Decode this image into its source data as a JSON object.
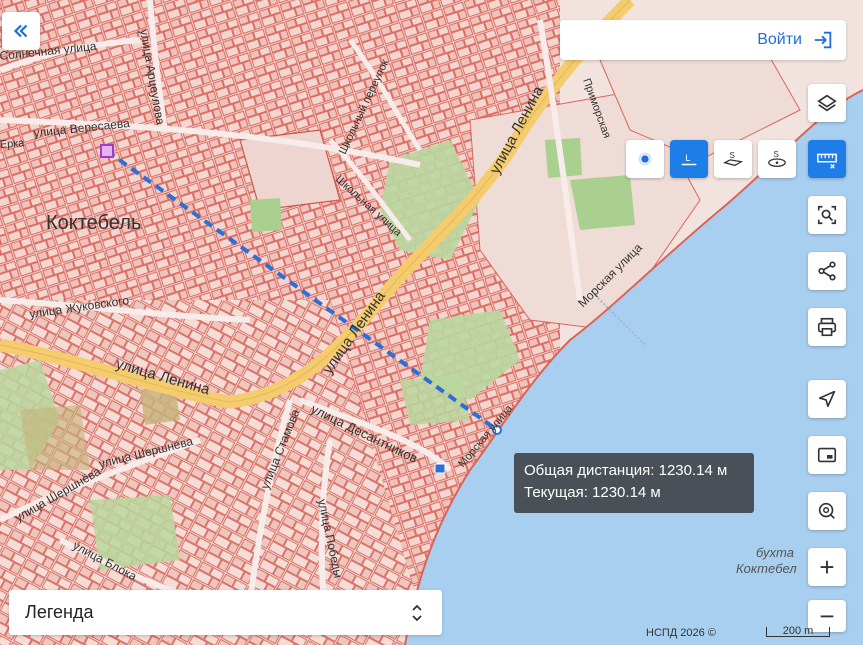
{
  "header": {
    "collapse_icon": "double-chevron-left-icon",
    "login_label": "Войти",
    "login_icon": "sign-in-icon"
  },
  "map": {
    "town_label": "Коктебель",
    "bay_label_1": "бухта",
    "bay_label_2": "Коктебел",
    "streets": {
      "solnechnaya": "Солнечная улица",
      "arshintseva": "улица Арцеулова",
      "veresaeva": "улица Вересаева",
      "zhukovskogo": "улица Жуковского",
      "lenina_1": "улица Ленина",
      "lenina_2": "улица Ленина",
      "lenina_3": "улица Ленина",
      "shkolny_per": "Школьный переулок",
      "shkolnaya": "Школьная улица",
      "primorskaya": "Приморская",
      "morskaya_1": "Морская улица",
      "morskaya_2": "Морская улица",
      "desantnikov": "улица Десантников",
      "stamova": "улица Стамова",
      "shershnya": "улица Шершнёва",
      "shershnya2": "улица Шершнёва",
      "bloka": "улица Блока",
      "pobedy": "улица Победы",
      "edge": "Ерка"
    },
    "colors": {
      "land": "#f2e3df",
      "parcel_border": "#d9655a",
      "parcel_fill": "#f0c9c2",
      "sea": "#a9cff0",
      "green": "#b9d79e",
      "main_road": "#f4cc6e",
      "measure_line": "#2e6fd6"
    }
  },
  "tooltip": {
    "total": "Общая дистанция: 1230.14 м",
    "current": "Текущая: 1230.14 м"
  },
  "toolbar": {
    "layers_icon": "layers-icon",
    "measure_icon": "ruler-icon",
    "select_area_icon": "select-area-icon",
    "share_icon": "share-icon",
    "print_icon": "printer-icon",
    "locate_icon": "navigation-arrow-icon",
    "minimap_icon": "picture-in-picture-icon",
    "search_location_icon": "location-search-icon",
    "zoom_in": "+",
    "zoom_out": "−"
  },
  "measure_modes": {
    "point": "point-mode-icon",
    "length": "L",
    "area": "S",
    "area_alt": "S"
  },
  "legend": {
    "label": "Легенда"
  },
  "footer": {
    "copyright": "НСПД 2026 ©",
    "scale_label": "200 m"
  }
}
